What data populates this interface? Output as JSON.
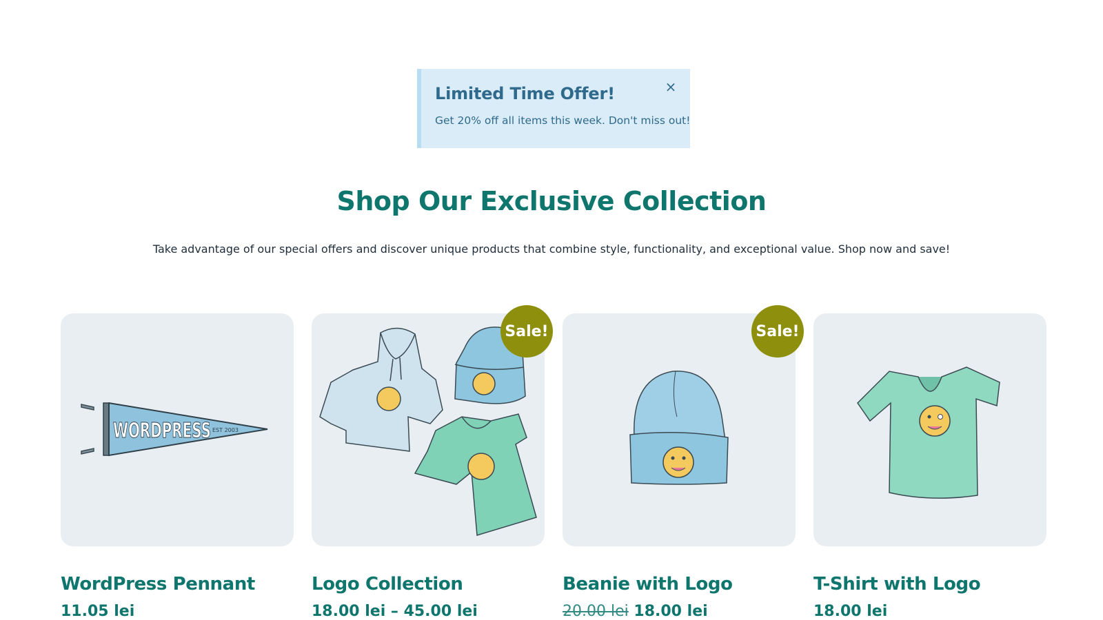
{
  "notice": {
    "title": "Limited Time Offer!",
    "text": "Get 20% off all items this week. Don't miss out!",
    "close_icon": "×"
  },
  "section": {
    "heading": "Shop Our Exclusive Collection",
    "intro": "Take advantage of our special offers and discover unique products that combine style, functionality, and exceptional value. Shop now and save!"
  },
  "products": [
    {
      "name": "WordPress Pennant",
      "price": "11.05 lei",
      "old_price": "",
      "sale": false,
      "image": "pennant-image"
    },
    {
      "name": "Logo Collection",
      "price": "18.00 lei – 45.00 lei",
      "old_price": "",
      "sale": true,
      "sale_label": "Sale!",
      "image": "logo-collection-image"
    },
    {
      "name": "Beanie with Logo",
      "price": "18.00 lei",
      "old_price": "20.00 lei",
      "sale": true,
      "sale_label": "Sale!",
      "image": "beanie-image"
    },
    {
      "name": "T-Shirt with Logo",
      "price": "18.00 lei",
      "old_price": "",
      "sale": false,
      "image": "tshirt-image"
    }
  ],
  "images": {
    "pennant_text": "WORDPRESS",
    "pennant_sub": "EST 2003"
  },
  "colors": {
    "accent": "#0f766e",
    "notice_bg": "#daecf7",
    "notice_text": "#2f6a8c",
    "sale_badge": "#8f8f0e",
    "card_bg": "#e8eef2"
  }
}
